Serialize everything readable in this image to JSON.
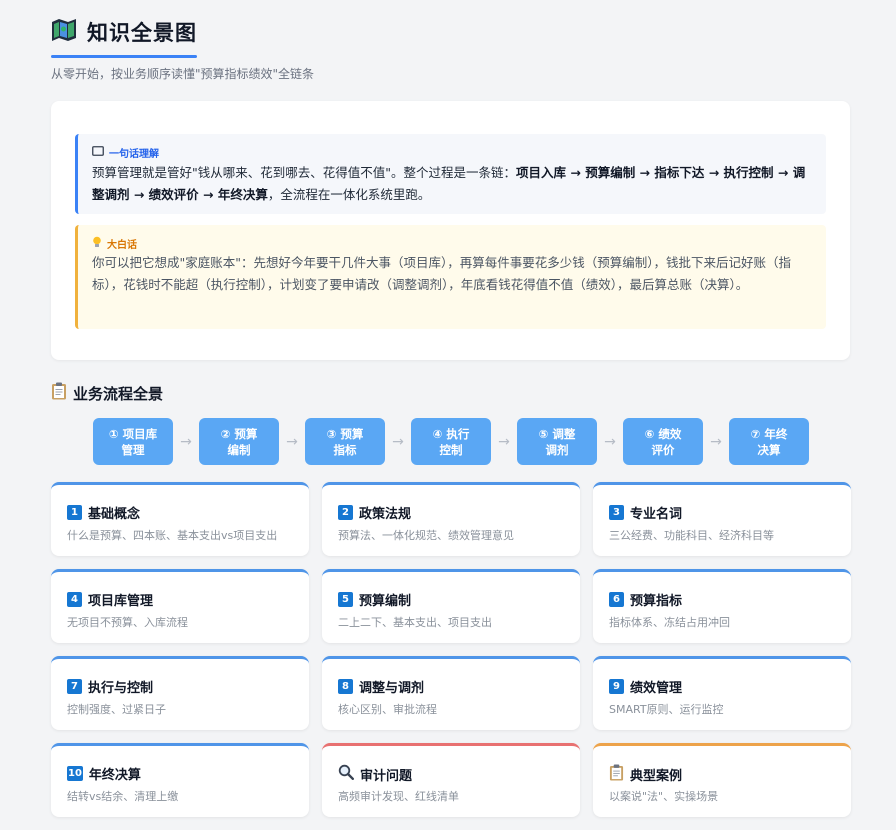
{
  "header": {
    "title": "知识全景图",
    "subtitle": "从零开始，按业务顺序读懂\"预算指标绩效\"全链条"
  },
  "summary": {
    "oneline": {
      "label": "一句话理解",
      "text_pre": "预算管理就是管好\"钱从哪来、花到哪去、花得值不值\"。整个过程是一条链：",
      "chain": "项目入库 → 预算编制 → 指标下达 → 执行控制 → 调整调剂 → 绩效评价 → 年终决算",
      "text_post": "，全流程在一体化系统里跑。"
    },
    "plain": {
      "label": "大白话",
      "text": "你可以把它想成\"家庭账本\"：先想好今年要干几件大事（项目库），再算每件事要花多少钱（预算编制），钱批下来后记好账（指标），花钱时不能超（执行控制），计划变了要申请改（调整调剂），年底看钱花得值不值（绩效），最后算总账（决算）。"
    }
  },
  "flow": {
    "title": "业务流程全景",
    "steps": [
      {
        "line1": "① 项目库",
        "line2": "管理"
      },
      {
        "line1": "② 预算",
        "line2": "编制"
      },
      {
        "line1": "③ 预算",
        "line2": "指标"
      },
      {
        "line1": "④ 执行",
        "line2": "控制"
      },
      {
        "line1": "⑤ 调整",
        "line2": "调剂"
      },
      {
        "line1": "⑥ 绩效",
        "line2": "评价"
      },
      {
        "line1": "⑦ 年终",
        "line2": "决算"
      }
    ],
    "arrow": "→"
  },
  "modules": [
    {
      "badge": "1",
      "title": "基础概念",
      "desc": "什么是预算、四本账、基本支出vs项目支出"
    },
    {
      "badge": "2",
      "title": "政策法规",
      "desc": "预算法、一体化规范、绩效管理意见"
    },
    {
      "badge": "3",
      "title": "专业名词",
      "desc": "三公经费、功能科目、经济科目等"
    },
    {
      "badge": "4",
      "title": "项目库管理",
      "desc": "无项目不预算、入库流程"
    },
    {
      "badge": "5",
      "title": "预算编制",
      "desc": "二上二下、基本支出、项目支出"
    },
    {
      "badge": "6",
      "title": "预算指标",
      "desc": "指标体系、冻结占用冲回"
    },
    {
      "badge": "7",
      "title": "执行与控制",
      "desc": "控制强度、过紧日子"
    },
    {
      "badge": "8",
      "title": "调整与调剂",
      "desc": "核心区别、审批流程"
    },
    {
      "badge": "9",
      "title": "绩效管理",
      "desc": "SMART原则、运行监控"
    },
    {
      "badge": "10",
      "title": "年终决算",
      "desc": "结转vs结余、清理上缴"
    },
    {
      "title": "审计问题",
      "desc": "高频审计发现、红线清单"
    },
    {
      "title": "典型案例",
      "desc": "以案说\"法\"、实操场景"
    }
  ],
  "icons": {
    "title": "map-icon",
    "oneline": "book-icon",
    "plain": "lightbulb-icon",
    "flow": "clipboard-icon",
    "audit": "magnifier-icon",
    "cases": "clipboard-icon"
  },
  "colors": {
    "accent": "#3b82f6",
    "step": "#5aa7f4",
    "badge": "#1677d2",
    "audit_border": "#e87171",
    "case_border": "#eda34a",
    "plain_border": "#f0b13c"
  }
}
